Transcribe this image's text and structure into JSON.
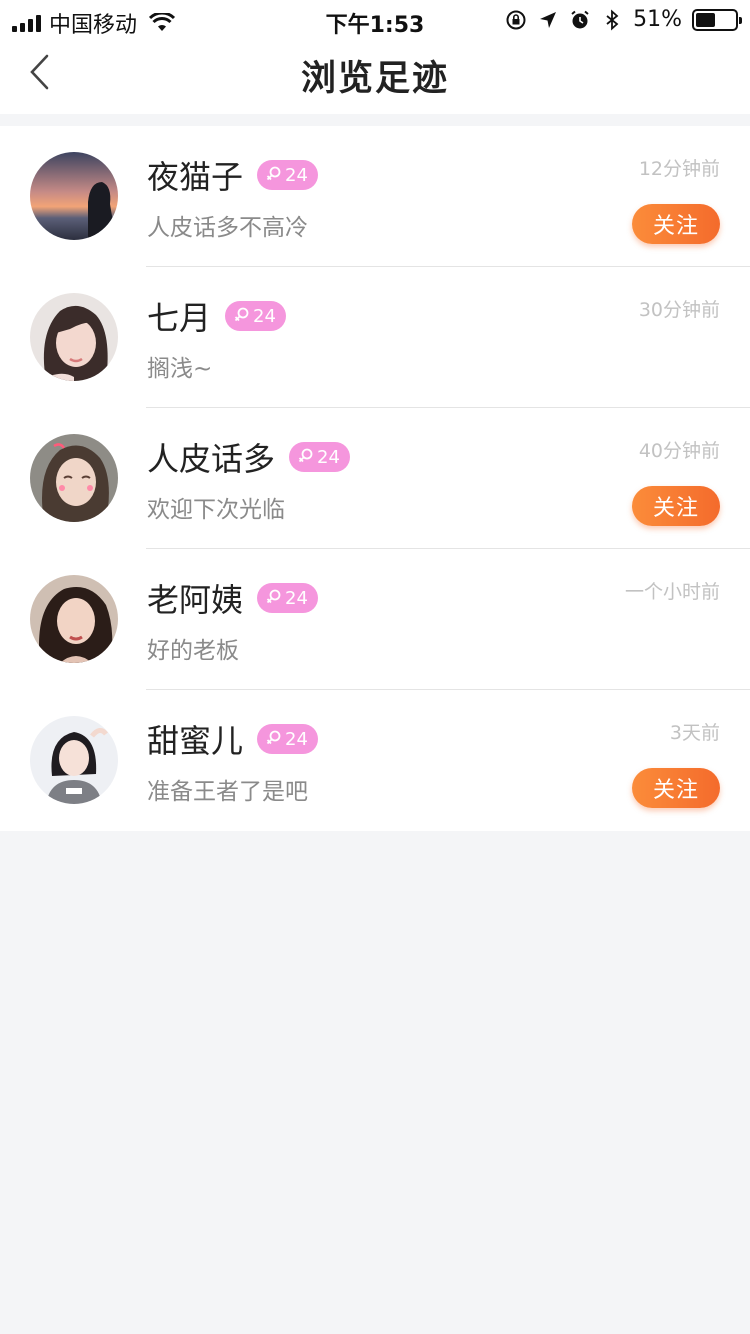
{
  "status_bar": {
    "carrier": "中国移动",
    "time": "下午1:53",
    "battery_percent_text": "51%",
    "battery_level": 0.51,
    "icons": [
      "signal-icon",
      "wifi-icon",
      "rotation-lock-icon",
      "location-icon",
      "alarm-icon",
      "bluetooth-icon",
      "battery-icon"
    ]
  },
  "nav": {
    "title": "浏览足迹",
    "back_icon": "chevron-left-icon"
  },
  "colors": {
    "badge": "#f596dd",
    "follow_gradient_start": "#fb8c3a",
    "follow_gradient_end": "#f46b2c",
    "background": "#f4f5f7"
  },
  "visitors": [
    {
      "name": "夜猫子",
      "badge": "24",
      "badge_icon": "female-icon",
      "signature": "人皮话多不高冷",
      "time": "12分钟前",
      "follow_label": "关注"
    },
    {
      "name": "七月",
      "badge": "24",
      "badge_icon": "female-icon",
      "signature": "搁浅~",
      "time": "30分钟前"
    },
    {
      "name": "人皮话多",
      "badge": "24",
      "badge_icon": "female-icon",
      "signature": "欢迎下次光临",
      "time": "40分钟前",
      "follow_label": "关注"
    },
    {
      "name": "老阿姨",
      "badge": "24",
      "badge_icon": "female-icon",
      "signature": "好的老板",
      "time": "一个小时前"
    },
    {
      "name": "甜蜜儿",
      "badge": "24",
      "badge_icon": "female-icon",
      "signature": "准备王者了是吧",
      "time": "3天前",
      "follow_label": "关注"
    }
  ]
}
